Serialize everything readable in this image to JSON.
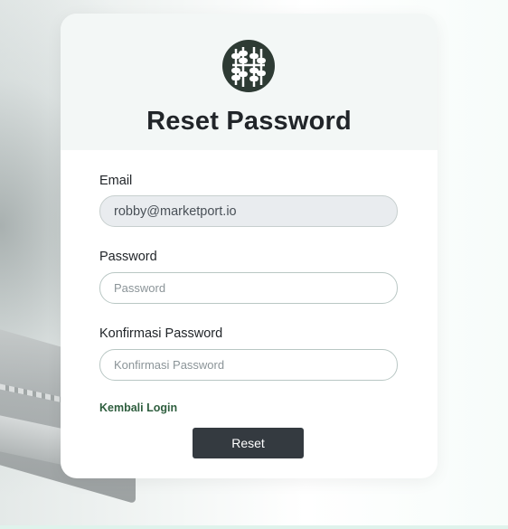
{
  "page": {
    "title": "Reset Password",
    "logo_icon": "abacus-icon",
    "colors": {
      "logo_bg": "#2e3b34",
      "button_bg": "#343a40",
      "link": "#2e5e3e"
    }
  },
  "form": {
    "email": {
      "label": "Email",
      "value": "robby@marketport.io",
      "disabled": true
    },
    "password": {
      "label": "Password",
      "placeholder": "Password"
    },
    "confirm_password": {
      "label": "Konfirmasi Password",
      "placeholder": "Konfirmasi Password"
    },
    "back_link": "Kembali Login",
    "submit_label": "Reset"
  }
}
